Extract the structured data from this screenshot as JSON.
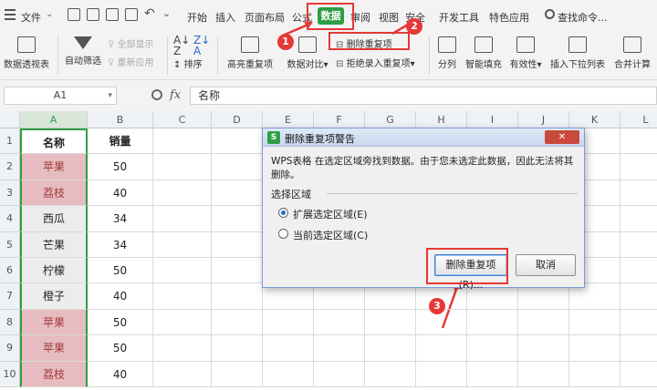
{
  "menu": {
    "file": "文件",
    "items": [
      "开始",
      "插入",
      "页面布局",
      "公式",
      "数据",
      "审阅",
      "视图",
      "安全",
      "开发工具",
      "特色应用"
    ],
    "search": "查找命令..."
  },
  "ribbon": {
    "pivot": "数据透视表",
    "autofilter": "自动筛选",
    "show_all": "全部显示",
    "reapply": "重新应用",
    "sort": "排序",
    "highlight_dup": "高亮重复项",
    "compare": "数据对比",
    "remove_dup": "删除重复项",
    "reject_dup": "拒绝录入重复项",
    "split": "分列",
    "smart_fill": "智能填充",
    "validity": "有效性",
    "dropdown": "插入下拉列表",
    "merge_calc": "合并计算"
  },
  "formula_bar": {
    "cell_ref": "A1",
    "fx": "fx",
    "value": "名称"
  },
  "columns": [
    "A",
    "B",
    "C",
    "D",
    "E",
    "F",
    "G",
    "H",
    "I",
    "J",
    "K",
    "L"
  ],
  "rows": [
    "1",
    "2",
    "3",
    "4",
    "5",
    "6",
    "7",
    "8",
    "9",
    "10"
  ],
  "table": {
    "headers": [
      "名称",
      "销量"
    ],
    "data": [
      [
        "苹果",
        "50"
      ],
      [
        "荔枝",
        "40"
      ],
      [
        "西瓜",
        "34"
      ],
      [
        "芒果",
        "34"
      ],
      [
        "柠檬",
        "50"
      ],
      [
        "橙子",
        "40"
      ],
      [
        "苹果",
        "50"
      ],
      [
        "苹果",
        "50"
      ],
      [
        "荔枝",
        "40"
      ]
    ]
  },
  "dialog": {
    "title": "删除重复项警告",
    "message_line1": "WPS表格 在选定区域旁找到数据。由于您未选定此数据，因此无法将其",
    "message_line2": "删除。",
    "group": "选择区域",
    "opt1": "扩展选定区域(E)",
    "opt2": "当前选定区域(C)",
    "ok": "删除重复项(R)...",
    "cancel": "取消"
  },
  "steps": [
    "1",
    "2",
    "3"
  ],
  "colors": {
    "accent_red": "#e53935",
    "data_tab_green": "#2e9e47",
    "dup_fill": "#e6bcc0",
    "dup_text": "#a23a3a",
    "selection_green": "#2e9e47"
  }
}
